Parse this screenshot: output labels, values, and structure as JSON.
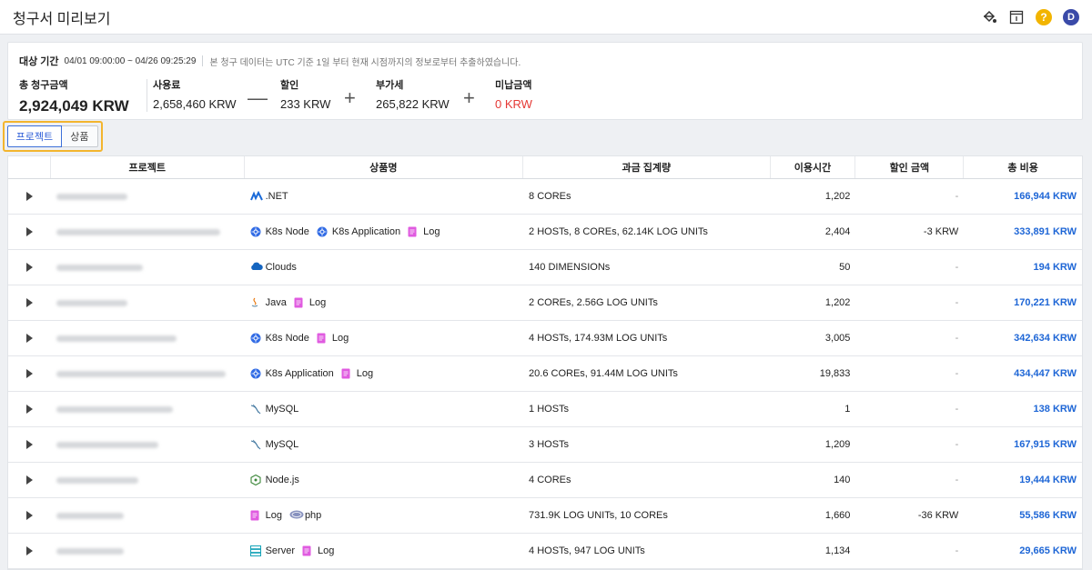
{
  "header": {
    "title": "청구서 미리보기",
    "avatar_initial": "D",
    "help_glyph": "?"
  },
  "summary": {
    "period_label": "대상 기간",
    "period_range": "04/01 09:00:00 ~ 04/26 09:25:29",
    "period_note": "본 청구 데이터는 UTC 기준 1일 부터 현재 시점까지의 정보로부터 추출하였습니다.",
    "total_label": "총 청구금액",
    "total_value": "2,924,049 KRW",
    "usage_label": "사용료",
    "usage_value": "2,658,460 KRW",
    "discount_label": "할인",
    "discount_value": "233 KRW",
    "vat_label": "부가세",
    "vat_value": "265,822 KRW",
    "unpaid_label": "미납금액",
    "unpaid_value": "0 KRW",
    "op_minus": "—",
    "op_plus1": "+",
    "op_plus2": "+"
  },
  "toggle": {
    "project_label": "프로젝트",
    "product_label": "상품"
  },
  "table": {
    "headers": [
      "프로젝트",
      "상품명",
      "과금 집계량",
      "이용시간",
      "할인 금액",
      "총 비용"
    ],
    "rows": [
      {
        "products": [
          {
            "icon": "dotnet-icon",
            "name": ".NET"
          }
        ],
        "usage": "8 COREs",
        "hours": "1,202",
        "discount": "-",
        "total": "166,944 KRW"
      },
      {
        "products": [
          {
            "icon": "k8s-icon",
            "name": "K8s Node"
          },
          {
            "icon": "k8s-icon",
            "name": "K8s Application"
          },
          {
            "icon": "log-icon",
            "name": "Log"
          }
        ],
        "usage": "2 HOSTs, 8 COREs, 62.14K LOG UNITs",
        "hours": "2,404",
        "discount": "-3 KRW",
        "total": "333,891 KRW"
      },
      {
        "products": [
          {
            "icon": "cloud-icon",
            "name": "Clouds"
          }
        ],
        "usage": "140 DIMENSIONs",
        "hours": "50",
        "discount": "-",
        "total": "194 KRW"
      },
      {
        "products": [
          {
            "icon": "java-icon",
            "name": "Java"
          },
          {
            "icon": "log-icon",
            "name": "Log"
          }
        ],
        "usage": "2 COREs, 2.56G LOG UNITs",
        "hours": "1,202",
        "discount": "-",
        "total": "170,221 KRW"
      },
      {
        "products": [
          {
            "icon": "k8s-icon",
            "name": "K8s Node"
          },
          {
            "icon": "log-icon",
            "name": "Log"
          }
        ],
        "usage": "4 HOSTs, 174.93M LOG UNITs",
        "hours": "3,005",
        "discount": "-",
        "total": "342,634 KRW"
      },
      {
        "products": [
          {
            "icon": "k8s-icon",
            "name": "K8s Application"
          },
          {
            "icon": "log-icon",
            "name": "Log"
          }
        ],
        "usage": "20.6 COREs, 91.44M LOG UNITs",
        "hours": "19,833",
        "discount": "-",
        "total": "434,447 KRW"
      },
      {
        "products": [
          {
            "icon": "mysql-icon",
            "name": "MySQL"
          }
        ],
        "usage": "1 HOSTs",
        "hours": "1",
        "discount": "-",
        "total": "138 KRW"
      },
      {
        "products": [
          {
            "icon": "mysql-icon",
            "name": "MySQL"
          }
        ],
        "usage": "3 HOSTs",
        "hours": "1,209",
        "discount": "-",
        "total": "167,915 KRW"
      },
      {
        "products": [
          {
            "icon": "nodejs-icon",
            "name": "Node.js"
          }
        ],
        "usage": "4 COREs",
        "hours": "140",
        "discount": "-",
        "total": "19,444 KRW"
      },
      {
        "products": [
          {
            "icon": "log-icon",
            "name": "Log"
          },
          {
            "icon": "php-icon",
            "name": "php"
          }
        ],
        "usage": "731.9K LOG UNITs, 10 COREs",
        "hours": "1,660",
        "discount": "-36 KRW",
        "total": "55,586 KRW"
      },
      {
        "products": [
          {
            "icon": "server-icon",
            "name": "Server"
          },
          {
            "icon": "log-icon",
            "name": "Log"
          }
        ],
        "usage": "4 HOSTs, 947 LOG UNITs",
        "hours": "1,134",
        "discount": "-",
        "total": "29,665 KRW"
      }
    ]
  },
  "colors": {
    "accent": "#1e66d6",
    "highlight": "#f3b52e",
    "negative": "#e53935"
  }
}
